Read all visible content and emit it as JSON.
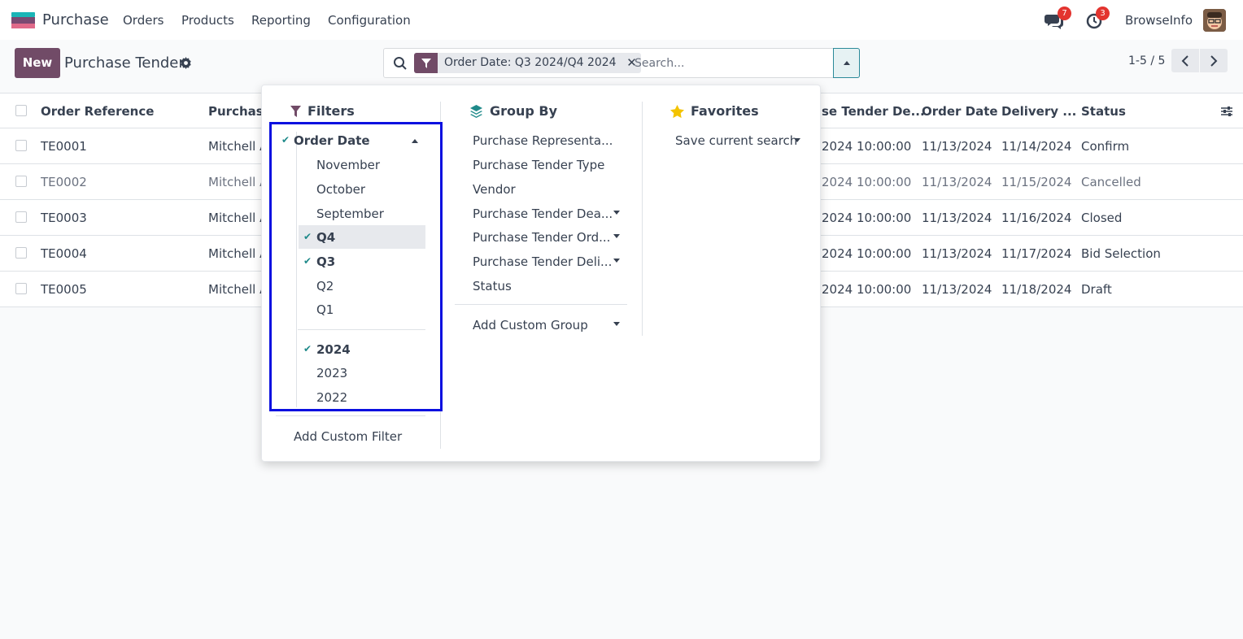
{
  "navbar": {
    "app_name": "Purchase",
    "menu": [
      "Orders",
      "Products",
      "Reporting",
      "Configuration"
    ],
    "messages_count": "7",
    "activities_count": "3",
    "user_name": "BrowseInfo"
  },
  "control_panel": {
    "new_label": "New",
    "breadcrumb": "Purchase Tender",
    "search": {
      "facet_value": "Order Date: Q3 2024/Q4 2024",
      "facet_remove": "✕",
      "placeholder": "Search..."
    },
    "pager": "1-5 / 5"
  },
  "list": {
    "columns": [
      "Order Reference",
      "Purchase",
      "se Tender De...",
      "Order Date",
      "Delivery ...",
      "Status"
    ],
    "rows": [
      {
        "ref": "TE0001",
        "purchase": "Mitchell A",
        "deadline": "2024 10:00:00",
        "order_date": "11/13/2024",
        "delivery": "11/14/2024",
        "status": "Confirm"
      },
      {
        "ref": "TE0002",
        "purchase": "Mitchell A",
        "deadline": "2024 10:00:00",
        "order_date": "11/13/2024",
        "delivery": "11/15/2024",
        "status": "Cancelled"
      },
      {
        "ref": "TE0003",
        "purchase": "Mitchell A",
        "deadline": "2024 10:00:00",
        "order_date": "11/13/2024",
        "delivery": "11/16/2024",
        "status": "Closed"
      },
      {
        "ref": "TE0004",
        "purchase": "Mitchell A",
        "deadline": "2024 10:00:00",
        "order_date": "11/13/2024",
        "delivery": "11/17/2024",
        "status": "Bid Selection"
      },
      {
        "ref": "TE0005",
        "purchase": "Mitchell A",
        "deadline": "2024 10:00:00",
        "order_date": "11/13/2024",
        "delivery": "11/18/2024",
        "status": "Draft"
      }
    ]
  },
  "filters": {
    "title": "Filters",
    "order_date_label": "Order Date",
    "months": [
      "November",
      "October",
      "September"
    ],
    "quarters": [
      "Q4",
      "Q3",
      "Q2",
      "Q1"
    ],
    "years": [
      "2024",
      "2023",
      "2022"
    ],
    "selected": [
      "Q4",
      "Q3",
      "2024"
    ],
    "add_custom": "Add Custom Filter"
  },
  "group_by": {
    "title": "Group By",
    "items": [
      "Purchase Representa...",
      "Purchase Tender Type",
      "Vendor",
      "Purchase Tender Dea...",
      "Purchase Tender Ord...",
      "Purchase Tender Deli...",
      "Status"
    ],
    "add_custom": "Add Custom Group"
  },
  "favorites": {
    "title": "Favorites",
    "save_current": "Save current search"
  },
  "colors": {
    "brand": "#714b67",
    "accent": "#1f8a8a",
    "highlight_border": "#0a10e0",
    "badge": "#e3342f"
  }
}
